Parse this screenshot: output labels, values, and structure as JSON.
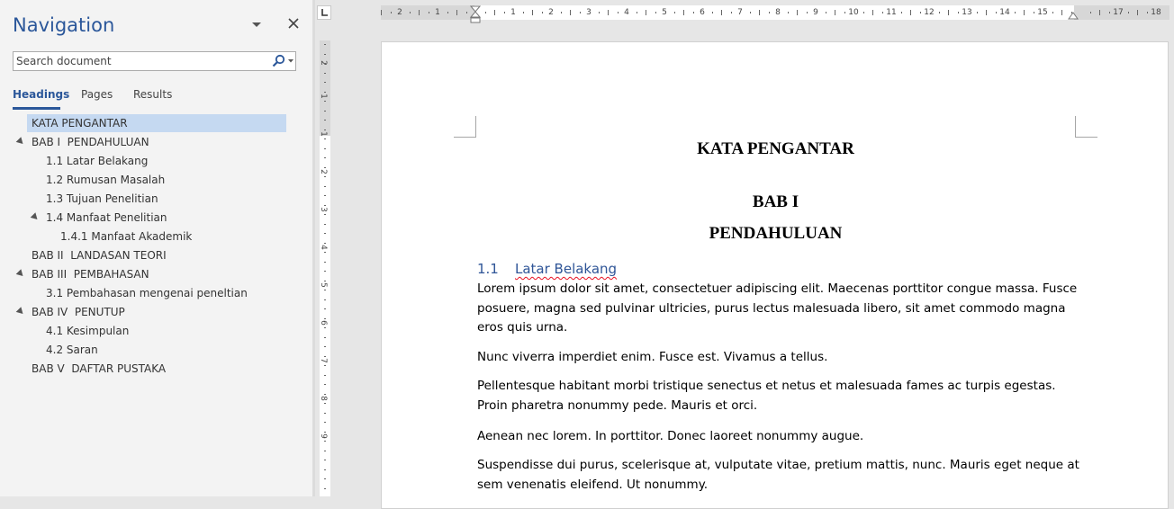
{
  "navigation": {
    "title": "Navigation",
    "search": {
      "placeholder": "Search document",
      "value": ""
    },
    "tabs": [
      {
        "label": "Headings",
        "active": true
      },
      {
        "label": "Pages",
        "active": false
      },
      {
        "label": "Results",
        "active": false
      }
    ],
    "headings": [
      {
        "label": "KATA PENGANTAR",
        "level": 1,
        "selected": true,
        "expandable": false
      },
      {
        "label": "BAB I  PENDAHULUAN",
        "level": 1,
        "selected": false,
        "expandable": true
      },
      {
        "label": "1.1 Latar Belakang",
        "level": 2,
        "selected": false,
        "expandable": false
      },
      {
        "label": "1.2 Rumusan Masalah",
        "level": 2,
        "selected": false,
        "expandable": false
      },
      {
        "label": "1.3 Tujuan Penelitian",
        "level": 2,
        "selected": false,
        "expandable": false
      },
      {
        "label": "1.4 Manfaat Penelitian",
        "level": 2,
        "selected": false,
        "expandable": true
      },
      {
        "label": "1.4.1 Manfaat Akademik",
        "level": 3,
        "selected": false,
        "expandable": false
      },
      {
        "label": "BAB II  LANDASAN TEORI",
        "level": 1,
        "selected": false,
        "expandable": false
      },
      {
        "label": "BAB III  PEMBAHASAN",
        "level": 1,
        "selected": false,
        "expandable": true
      },
      {
        "label": "3.1 Pembahasan mengenai peneltian",
        "level": 2,
        "selected": false,
        "expandable": false
      },
      {
        "label": "BAB IV  PENUTUP",
        "level": 1,
        "selected": false,
        "expandable": true
      },
      {
        "label": "4.1 Kesimpulan",
        "level": 2,
        "selected": false,
        "expandable": false
      },
      {
        "label": "4.2 Saran",
        "level": 2,
        "selected": false,
        "expandable": false
      },
      {
        "label": "BAB V  DAFTAR PUSTAKA",
        "level": 1,
        "selected": false,
        "expandable": false
      }
    ]
  },
  "ruler": {
    "horizontal_labels": [
      "2",
      "1",
      "1",
      "2",
      "3",
      "4",
      "5",
      "6",
      "7",
      "8",
      "9",
      "10",
      "11",
      "12",
      "13",
      "14",
      "15",
      "17",
      "18"
    ],
    "vertical_labels": [
      "2",
      "1",
      "1",
      "2",
      "3",
      "4",
      "5",
      "6",
      "7",
      "8",
      "9"
    ]
  },
  "document": {
    "title": "KATA PENGANTAR",
    "chapter_line1": "BAB I",
    "chapter_line2": "PENDAHULUAN",
    "section_number": "1.1",
    "section_title": "Latar Belakang",
    "paragraphs": [
      "Lorem ipsum dolor sit amet, consectetuer adipiscing elit. Maecenas porttitor congue massa. Fusce posuere, magna sed pulvinar ultricies, purus lectus malesuada libero, sit amet commodo magna eros quis urna.",
      "Nunc viverra imperdiet enim. Fusce est. Vivamus a tellus.",
      "Pellentesque habitant morbi tristique senectus et netus et malesuada fames ac turpis egestas. Proin pharetra nonummy pede. Mauris et orci.",
      "Aenean nec lorem. In porttitor. Donec laoreet nonummy augue.",
      "Suspendisse dui purus, scelerisque at, vulputate vitae, pretium mattis, nunc. Mauris eget neque at sem venenatis eleifend. Ut nonummy."
    ]
  },
  "colors": {
    "accent": "#2b579a",
    "heading2": "#2f5597",
    "selection": "#c5d9f1"
  }
}
